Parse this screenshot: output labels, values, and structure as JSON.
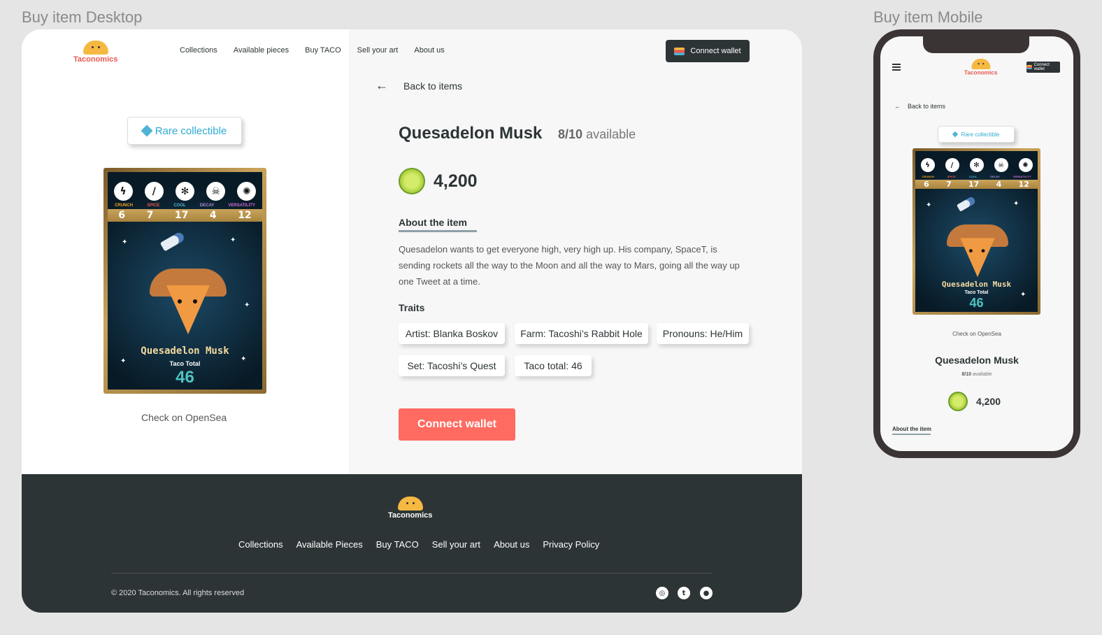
{
  "frames": {
    "desktop_title": "Buy item Desktop",
    "mobile_title": "Buy item Mobile"
  },
  "brand": {
    "name": "Taconomics"
  },
  "nav": {
    "links": [
      "Collections",
      "Available pieces",
      "Buy TACO",
      "Sell your art",
      "About us"
    ],
    "connect_label": "Connect wallet"
  },
  "back_label": "Back to items",
  "badge": {
    "label": "Rare collectible"
  },
  "card": {
    "traits": [
      {
        "label": "CRUNCH",
        "value": "6",
        "color": "#f5a623",
        "icon": "lightning-icon"
      },
      {
        "label": "SPICE",
        "value": "7",
        "color": "#e8584f",
        "icon": "chili-icon"
      },
      {
        "label": "COOL",
        "value": "17",
        "color": "#4fb3d4",
        "icon": "snowflake-icon"
      },
      {
        "label": "DECAY",
        "value": "4",
        "color": "#b08ed8",
        "icon": "skull-icon"
      },
      {
        "label": "VERSATILITY",
        "value": "12",
        "color": "#c86dd7",
        "icon": "sun-icon"
      }
    ],
    "name": "Quesadelon Musk",
    "total_label": "Taco Total",
    "total": "46"
  },
  "opensea_label": "Check on OpenSea",
  "item": {
    "title": "Quesadelon Musk",
    "available_count": "8/10",
    "available_word": "available",
    "price": "4,200",
    "about_heading": "About the item",
    "about_text": "Quesadelon wants to get everyone high, very high up. His company, SpaceT, is sending rockets all the way to the Moon and all the way to Mars, going all the way up one Tweet at a time.",
    "traits_heading": "Traits",
    "traits": [
      "Artist: Blanka Boskov",
      "Farm: Tacoshi’s Rabbit Hole",
      "Pronouns: He/Him",
      "Set: Tacoshi’s Quest",
      "Taco total: 46"
    ],
    "cta_label": "Connect wallet"
  },
  "footer": {
    "links": [
      "Collections",
      "Available Pieces",
      "Buy TACO",
      "Sell your art",
      "About us",
      "Privacy Policy"
    ],
    "copyright": "© 2020 Taconomics. All rights reserved",
    "social": [
      "instagram-icon",
      "twitter-icon",
      "medium-icon"
    ]
  },
  "mobile": {
    "connect_label": "Connect wallet"
  },
  "colors": {
    "accent": "#ff6b61",
    "dark": "#2d3436",
    "badge_text": "#2eaad1"
  }
}
